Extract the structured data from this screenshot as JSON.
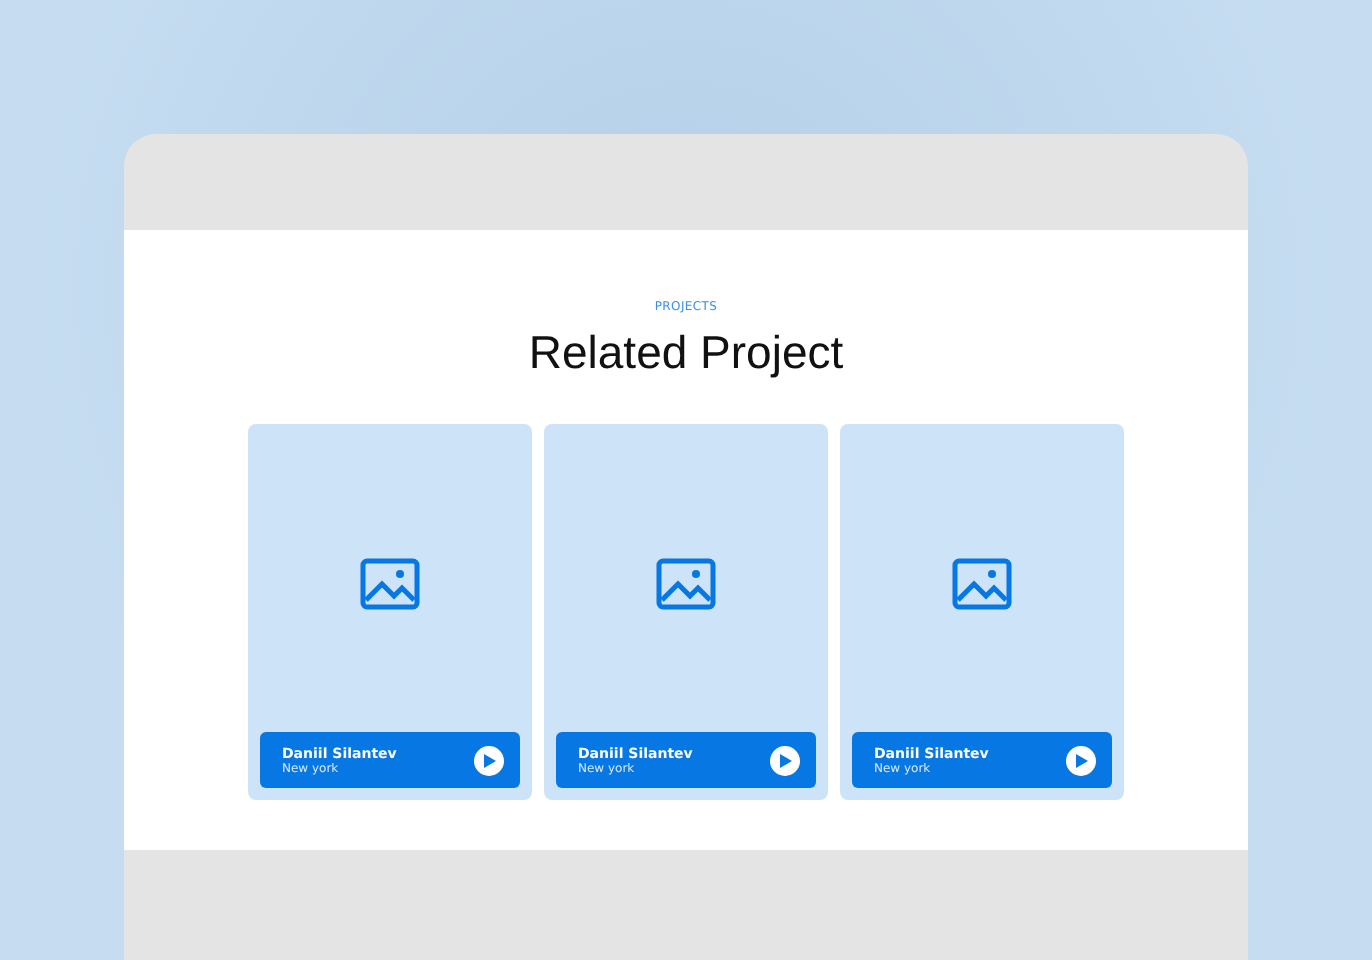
{
  "section": {
    "eyebrow": "PROJECTS",
    "title": "Related Project"
  },
  "projects": [
    {
      "name": "Daniil Silantev",
      "location": "New york",
      "kind": "picture"
    },
    {
      "name": "Daniil Silantev",
      "location": "New york",
      "kind": "picture"
    },
    {
      "name": "Daniil Silantev",
      "location": "New york",
      "kind": "picture"
    }
  ]
}
